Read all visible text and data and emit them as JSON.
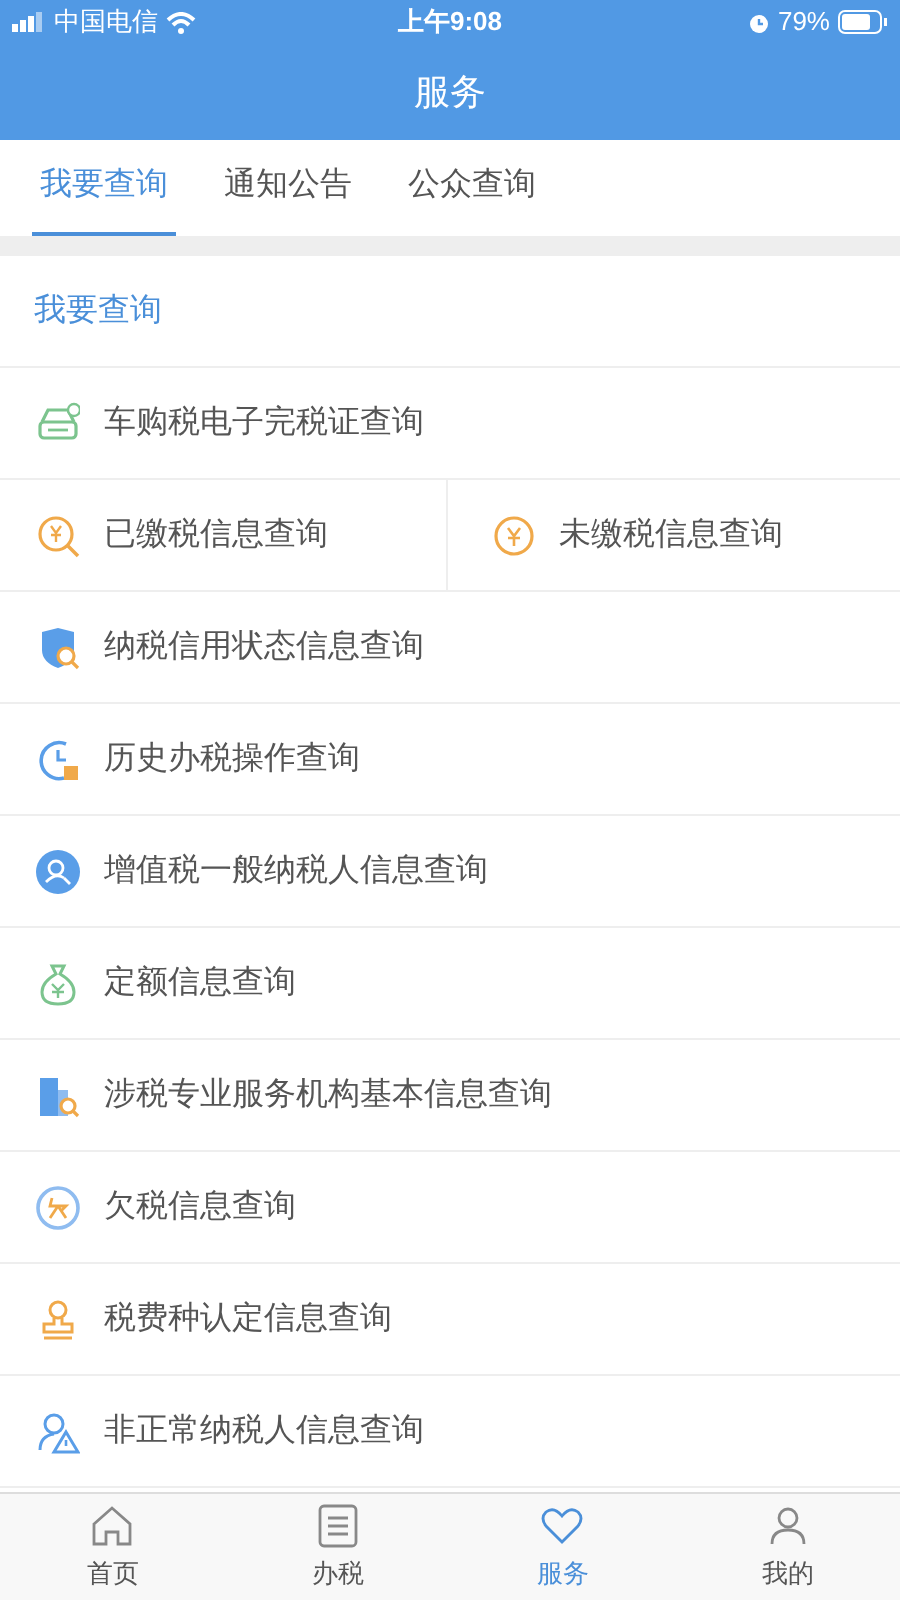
{
  "status_bar": {
    "carrier": "中国电信",
    "time": "上午9:08",
    "battery": "79%"
  },
  "title": "服务",
  "tabs": [
    {
      "label": "我要查询",
      "selected": true
    },
    {
      "label": "通知公告",
      "selected": false
    },
    {
      "label": "公众查询",
      "selected": false
    }
  ],
  "section_title": "我要查询",
  "rows": [
    {
      "cells": [
        "车购税电子完税证查询"
      ]
    },
    {
      "cells": [
        "已缴税信息查询",
        "未缴税信息查询"
      ]
    },
    {
      "cells": [
        "纳税信用状态信息查询"
      ]
    },
    {
      "cells": [
        "历史办税操作查询"
      ]
    },
    {
      "cells": [
        "增值税一般纳税人信息查询"
      ]
    },
    {
      "cells": [
        "定额信息查询"
      ]
    },
    {
      "cells": [
        "涉税专业服务机构基本信息查询"
      ]
    },
    {
      "cells": [
        "欠税信息查询"
      ]
    },
    {
      "cells": [
        "税费种认定信息查询"
      ]
    },
    {
      "cells": [
        "非正常纳税人信息查询"
      ]
    }
  ],
  "bottom_nav": [
    {
      "label": "首页",
      "selected": false
    },
    {
      "label": "办税",
      "selected": false
    },
    {
      "label": "服务",
      "selected": true
    },
    {
      "label": "我的",
      "selected": false
    }
  ]
}
